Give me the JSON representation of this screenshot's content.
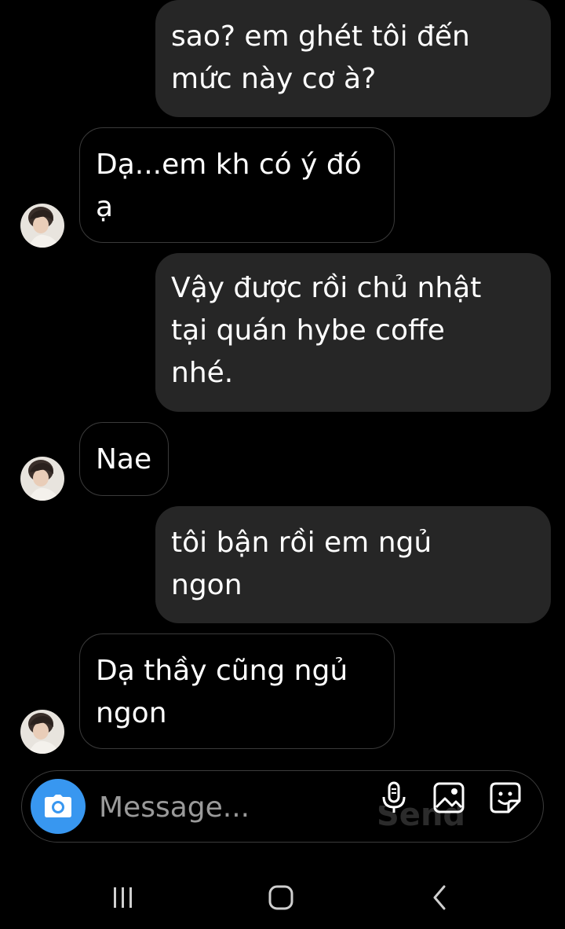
{
  "messages": [
    {
      "direction": "outgoing",
      "text": "sao? em ghét tôi đến\nmức này cơ à?"
    },
    {
      "direction": "incoming",
      "text": "Dạ...em kh có ý đó\nạ"
    },
    {
      "direction": "outgoing",
      "text": "Vậy được rồi chủ nhật\ntại quán hybe coffe\nnhé."
    },
    {
      "direction": "incoming",
      "text": "Nae"
    },
    {
      "direction": "outgoing",
      "text": "tôi bận rồi em ngủ\nngon"
    },
    {
      "direction": "incoming",
      "text": "Dạ thầy cũng ngủ\nngon"
    }
  ],
  "composer": {
    "placeholder": "Message...",
    "send_label": "Send",
    "icons": [
      "camera-icon",
      "microphone-icon",
      "gallery-icon",
      "sticker-icon"
    ]
  },
  "nav_bar": {
    "icons": [
      "recent-apps-icon",
      "home-icon",
      "back-icon"
    ]
  },
  "colors": {
    "background": "#000000",
    "outgoing_bubble": "#262626",
    "incoming_border": "#3a3a3a",
    "camera_button": "#3897f0",
    "placeholder": "#9a9a9a"
  }
}
